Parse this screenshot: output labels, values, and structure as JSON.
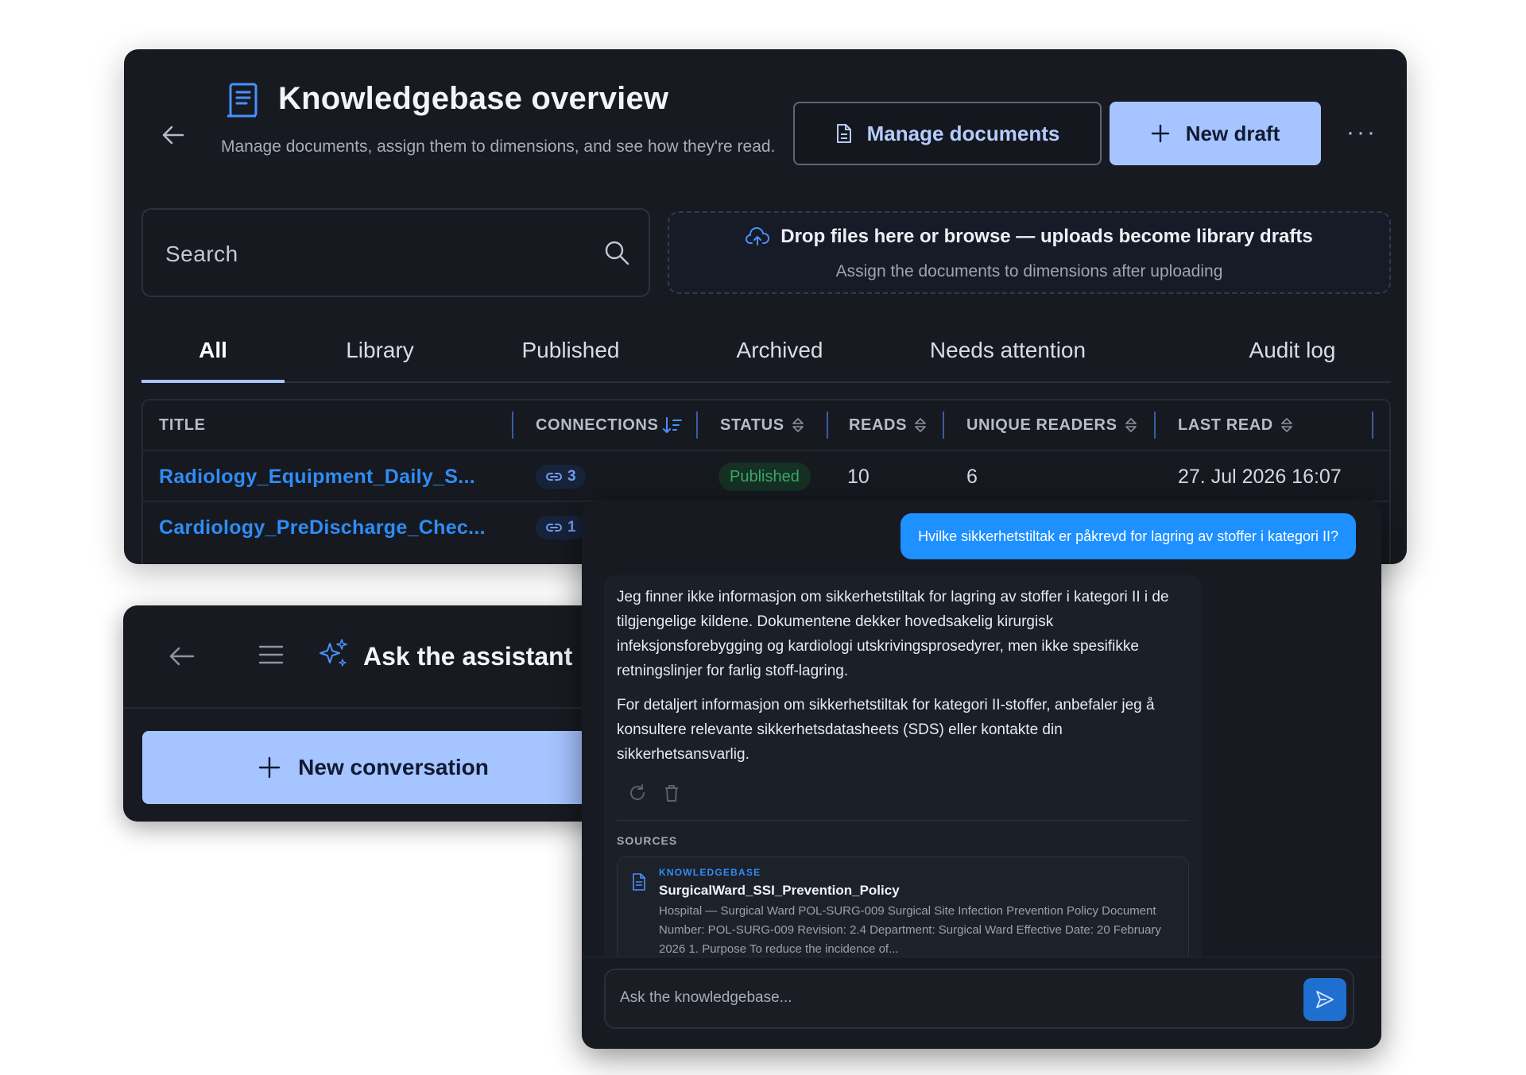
{
  "knowledgebase": {
    "title": "Knowledgebase overview",
    "subtitle": "Manage documents, assign them to dimensions, and see how they're read.",
    "manage_label": "Manage documents",
    "new_draft_label": "New draft",
    "more_label": "···",
    "search_placeholder": "Search",
    "drop_title": "Drop files here or browse — uploads become library drafts",
    "drop_subtitle": "Assign the documents to dimensions after uploading",
    "tabs": [
      "All",
      "Library",
      "Published",
      "Archived",
      "Needs attention",
      "Audit log"
    ],
    "active_tab": "All",
    "columns": [
      "TITLE",
      "CONNECTIONS",
      "STATUS",
      "READS",
      "UNIQUE READERS",
      "LAST READ"
    ],
    "rows": [
      {
        "title": "Radiology_Equipment_Daily_S...",
        "connections": "3",
        "status": "Published",
        "reads": "10",
        "unique_readers": "6",
        "last_read": "27. Jul 2026 16:07"
      },
      {
        "title": "Cardiology_PreDischarge_Chec...",
        "connections": "1",
        "status": "",
        "reads": "",
        "unique_readers": "",
        "last_read": ""
      }
    ]
  },
  "assistant": {
    "title": "Ask the assistant",
    "new_conversation_label": "New conversation"
  },
  "chat": {
    "user_message": "Hvilke sikkerhetstiltak er påkrevd for lagring av stoffer i kategori II?",
    "answer_paragraphs": [
      "Jeg finner ikke informasjon om sikkerhetstiltak for lagring av stoffer i kategori II i de tilgjengelige kildene. Dokumentene dekker hovedsakelig kirurgisk infeksjonsforebygging og kardiologi utskrivingsprosedyrer, men ikke spesifikke retningslinjer for farlig stoff-lagring.",
      "For detaljert informasjon om sikkerhetstiltak for kategori II-stoffer, anbefaler jeg å konsultere relevante sikkerhetsdatasheets (SDS) eller kontakte din sikkerhetsansvarlig."
    ],
    "sources_label": "SOURCES",
    "source": {
      "kicker": "KNOWLEDGEBASE",
      "title": "SurgicalWard_SSI_Prevention_Policy",
      "excerpt": "Hospital — Surgical Ward POL-SURG-009 Surgical Site Infection Prevention Policy Document Number: POL-SURG-009 Revision: 2.4 Department: Surgical Ward Effective Date: 20 February 2026 1. Purpose To reduce the incidence of..."
    },
    "input_placeholder": "Ask the knowledgebase..."
  },
  "colors": {
    "accent": "#a6c4ff",
    "link": "#2f8cf5",
    "user_bubble": "#1e90ff",
    "panel_bg": "#171a21",
    "published": "#3aa86a"
  }
}
